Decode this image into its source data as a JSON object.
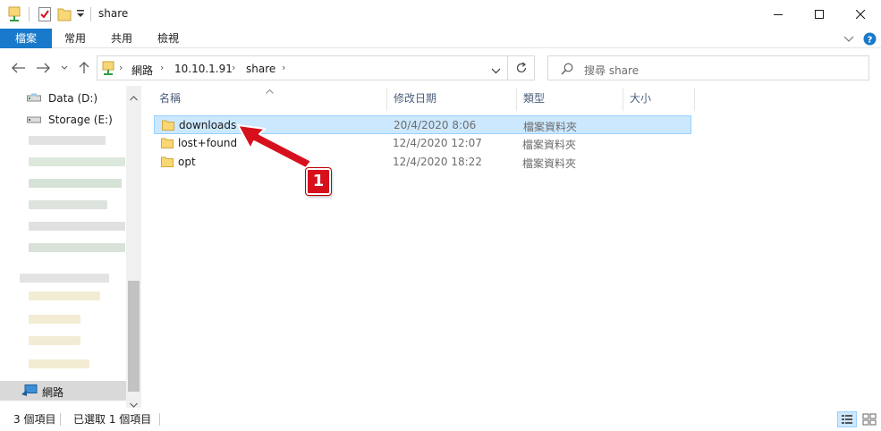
{
  "window": {
    "title": "share"
  },
  "ribbon": {
    "tabs": [
      "檔案",
      "常用",
      "共用",
      "檢視"
    ]
  },
  "address": {
    "crumbs": [
      "網路",
      "10.10.1.91",
      "share"
    ],
    "search_placeholder": "搜尋 share"
  },
  "nav": {
    "items": [
      {
        "label": "Data (D:)",
        "icon": "drive-icon"
      },
      {
        "label": "Storage (E:)",
        "icon": "drive-icon"
      }
    ],
    "network_label": "網路"
  },
  "list": {
    "headers": [
      "名稱",
      "修改日期",
      "類型",
      "大小"
    ],
    "rows": [
      {
        "name": "downloads",
        "date": "20/4/2020 8:06",
        "type": "檔案資料夾",
        "selected": true
      },
      {
        "name": "lost+found",
        "date": "12/4/2020 12:07",
        "type": "檔案資料夾",
        "selected": false
      },
      {
        "name": "opt",
        "date": "12/4/2020 18:22",
        "type": "檔案資料夾",
        "selected": false
      }
    ]
  },
  "status": {
    "count": "3 個項目",
    "selected": "已選取 1 個項目"
  },
  "annotation": {
    "label": "1"
  },
  "colors": {
    "accent": "#1979ca",
    "selection": "#cce8ff",
    "annotation": "#d6101c",
    "folder": "#f8d775"
  }
}
